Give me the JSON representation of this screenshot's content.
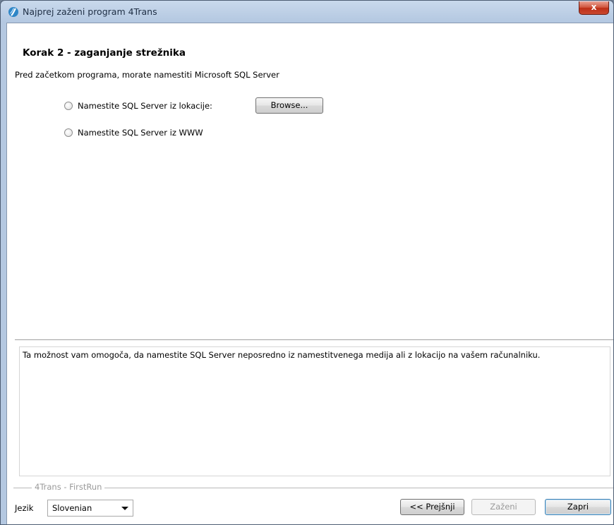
{
  "window": {
    "title": "Najprej zaženi program 4Trans",
    "close_label": "x"
  },
  "step": {
    "title": "Korak 2 - zaganjanje strežnika",
    "description": "Pred začetkom programa, morate namestiti Microsoft SQL Server"
  },
  "options": [
    {
      "label": "Namestite SQL Server iz lokacije:",
      "selected": false
    },
    {
      "label": "Namestite SQL Server iz WWW",
      "selected": false
    }
  ],
  "browse_label": "Browse...",
  "info_text": "Ta možnost vam omogoča, da namestite SQL Server neposredno iz namestitvenega medija ali z lokacijo na vašem računalniku.",
  "footer": {
    "group_label": "4Trans - FirstRun",
    "language_label": "Jezik",
    "language_value": "Slovenian",
    "back_label": "<< Prejšnji",
    "run_label": "Zaženi",
    "close_label": "Zapri"
  },
  "icons": {
    "app": "app-icon",
    "close": "close-icon",
    "dropdown": "chevron-down-icon"
  },
  "colors": {
    "title_bar": "#b4c8e1",
    "close_button": "#c9492f",
    "focus_border": "#3c7fb1"
  }
}
